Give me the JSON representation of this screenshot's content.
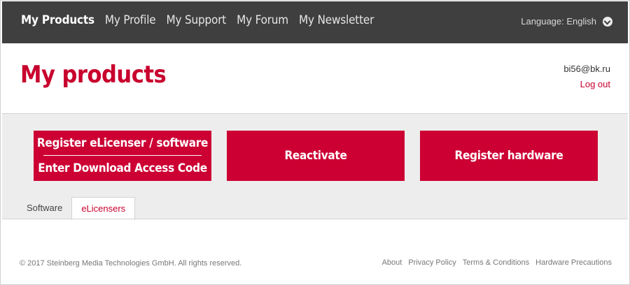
{
  "nav": {
    "items": [
      {
        "label": "My Products",
        "active": true
      },
      {
        "label": "My Profile",
        "active": false
      },
      {
        "label": "My Support",
        "active": false
      },
      {
        "label": "My Forum",
        "active": false
      },
      {
        "label": "My Newsletter",
        "active": false
      }
    ],
    "language_label": "Language: English",
    "language_icon": "chevron-down-circle-icon"
  },
  "header": {
    "title": "My products",
    "user_email": "bi56@bk.ru",
    "logout_label": "Log out"
  },
  "actions": {
    "register_elicenser": "Register eLicenser / software",
    "enter_download_code": "Enter Download Access Code",
    "reactivate": "Reactivate",
    "register_hardware": "Register hardware"
  },
  "tabs": [
    {
      "label": "Software",
      "active": false
    },
    {
      "label": "eLicensers",
      "active": true
    }
  ],
  "footer": {
    "copyright": "© 2017 Steinberg Media Technologies GmbH. All rights reserved.",
    "links": [
      "About",
      "Privacy Policy",
      "Terms & Conditions",
      "Hardware Precautions"
    ]
  },
  "colors": {
    "brand_red": "#cc0033",
    "nav_bg": "#3f3f3f",
    "band_bg": "#ededed"
  }
}
